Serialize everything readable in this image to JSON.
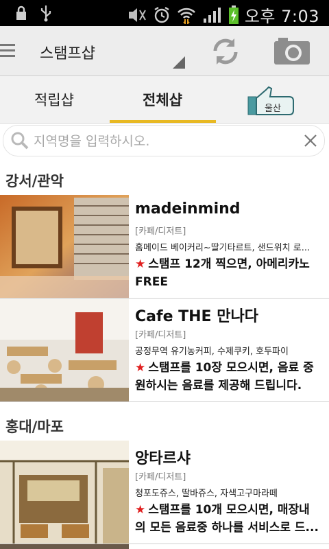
{
  "status_bar": {
    "time": "오후 7:03",
    "icons": [
      "lock-icon",
      "usb-icon",
      "silent-icon",
      "alarm-icon",
      "wifi-icon",
      "signal-icon",
      "battery-charging-icon"
    ]
  },
  "action_bar": {
    "title": "스탬프샵",
    "icons": [
      "menu-icon",
      "dropdown-indicator-icon",
      "refresh-icon",
      "camera-icon"
    ]
  },
  "tabs": [
    {
      "label": "적립샵",
      "active": false
    },
    {
      "label": "전체샵",
      "active": true
    }
  ],
  "region_badge": {
    "label": "울산"
  },
  "search": {
    "placeholder": "지역명을 입력하시오."
  },
  "accent_color": "#e8b923",
  "star_color": "#e02020",
  "sections": [
    {
      "title": "강서/관악",
      "items": [
        {
          "name": "madeinmind",
          "category": "[카페/디저트]",
          "desc": "홈메이드 베이커리~딸기타르트, 샌드위치 로...",
          "promo_line1": "스탬프 12개 찍으면, 아메리카노",
          "promo_line2": "FREE"
        },
        {
          "name": "Cafe THE 만나다",
          "category": "[카페/디저트]",
          "desc": "공정무역 유기농커피, 수제쿠키, 호두파이",
          "promo_line1": "스탬프를 10장 모으시면, 음료 중",
          "promo_line2": "원하시는 음료를 제공해 드립니다."
        }
      ]
    },
    {
      "title": "홍대/마포",
      "items": [
        {
          "name": "앙타르샤",
          "category": "[카페/디저트]",
          "desc": "청포도쥬스, 딸바쥬스, 자색고구마라떼",
          "promo_line1": "스탬프를 10개 모으시면, 매장내",
          "promo_line2": "의 모든 음료중 하나를 서비스로 드..."
        }
      ]
    }
  ]
}
